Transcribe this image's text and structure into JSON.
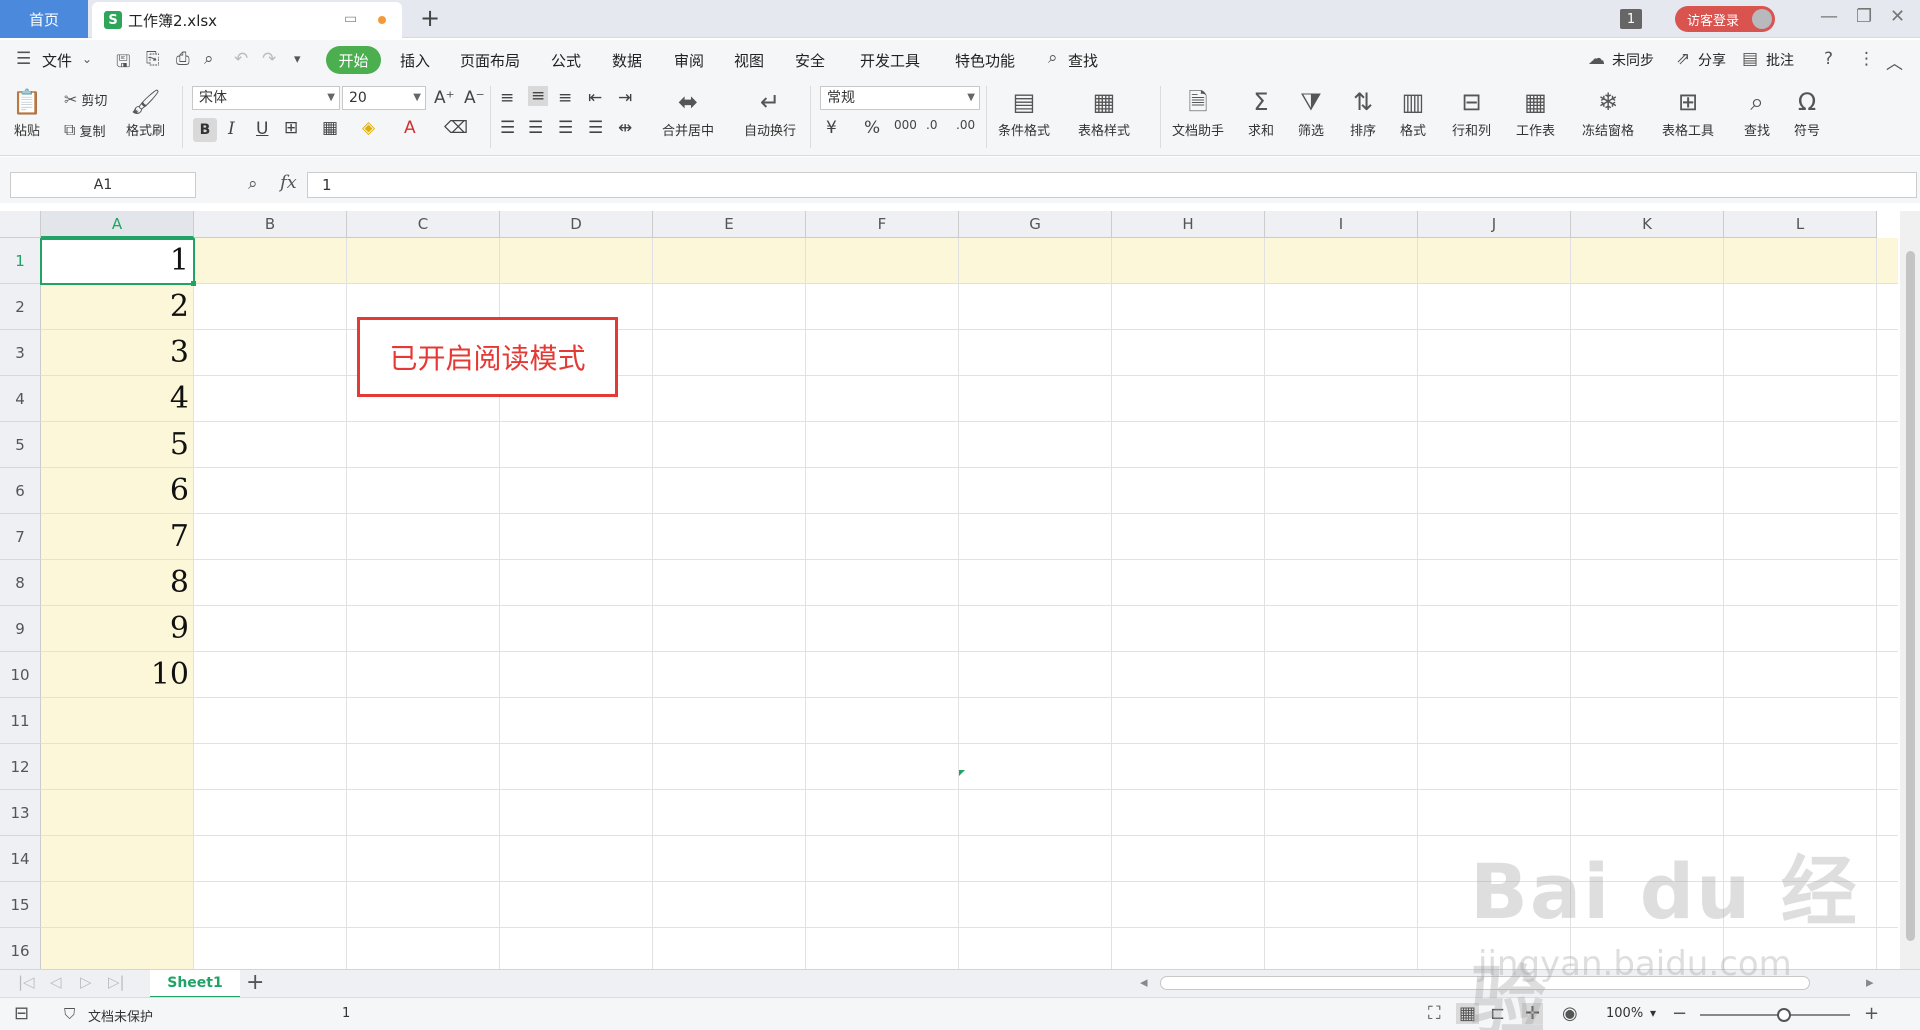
{
  "titlebar": {
    "home_tab": "首页",
    "doc_tab": "工作簿2.xlsx",
    "doc_icon_letter": "S",
    "window_count": "1",
    "login": "访客登录"
  },
  "menu": {
    "file": "文件",
    "items": [
      "开始",
      "插入",
      "页面布局",
      "公式",
      "数据",
      "审阅",
      "视图",
      "安全",
      "开发工具",
      "特色功能",
      "查找"
    ],
    "sync": "未同步",
    "share": "分享",
    "comment": "批注"
  },
  "ribbon": {
    "paste": "粘贴",
    "cut": "剪切",
    "copy": "复制",
    "format_painter": "格式刷",
    "font_name": "宋体",
    "font_size": "20",
    "merge_center": "合并居中",
    "wrap_text": "自动换行",
    "number_format": "常规",
    "cond_format": "条件格式",
    "table_style": "表格样式",
    "doc_helper": "文档助手",
    "sum": "求和",
    "filter": "筛选",
    "sort": "排序",
    "format": "格式",
    "row_col": "行和列",
    "worksheet": "工作表",
    "freeze": "冻结窗格",
    "table_tools": "表格工具",
    "find": "查找",
    "symbol": "符号"
  },
  "formula_bar": {
    "name_box": "A1",
    "fx": "fx",
    "value": "1"
  },
  "grid": {
    "columns": [
      "A",
      "B",
      "C",
      "D",
      "E",
      "F",
      "G",
      "H",
      "I",
      "J",
      "K",
      "L"
    ],
    "rows": [
      "1",
      "2",
      "3",
      "4",
      "5",
      "6",
      "7",
      "8",
      "9",
      "10",
      "11",
      "12",
      "13",
      "14",
      "15",
      "16"
    ],
    "col_a_values": [
      "1",
      "2",
      "3",
      "4",
      "5",
      "6",
      "7",
      "8",
      "9",
      "10"
    ],
    "notice": "已开启阅读模式"
  },
  "sheets": {
    "active": "Sheet1"
  },
  "status": {
    "protect": "文档未保护",
    "cell_value": "1",
    "zoom": "100%"
  },
  "watermark": {
    "main": "Bai du 经验",
    "sub": "jingyan.baidu.com"
  }
}
